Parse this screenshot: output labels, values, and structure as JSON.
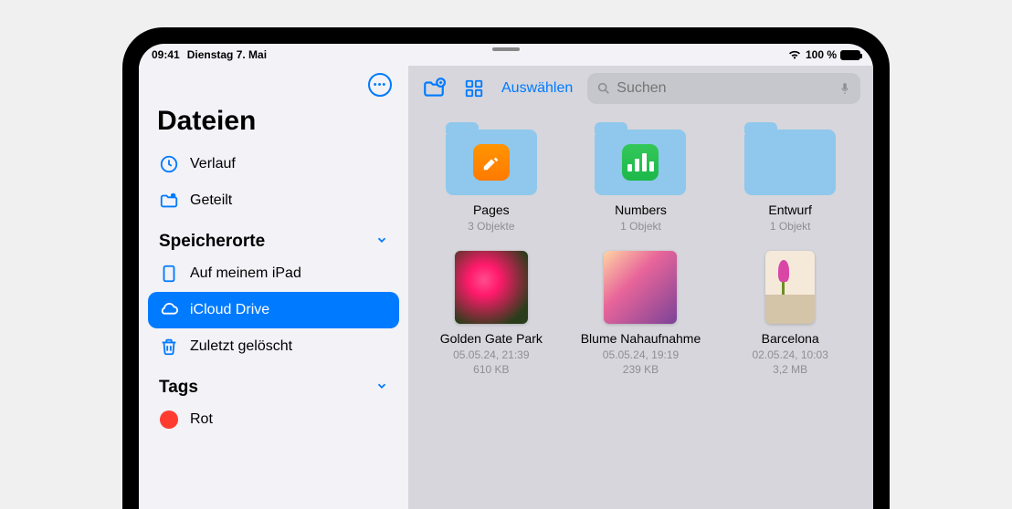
{
  "status": {
    "time": "09:41",
    "date": "Dienstag 7. Mai",
    "battery_pct": "100 %"
  },
  "sidebar": {
    "title": "Dateien",
    "recents": "Verlauf",
    "shared": "Geteilt",
    "locations_header": "Speicherorte",
    "on_ipad": "Auf meinem iPad",
    "icloud": "iCloud Drive",
    "trash": "Zuletzt gelöscht",
    "tags_header": "Tags",
    "tag_red": "Rot"
  },
  "toolbar": {
    "select": "Auswählen",
    "search_placeholder": "Suchen"
  },
  "grid": {
    "pages": {
      "name": "Pages",
      "sub": "3 Objekte"
    },
    "numbers": {
      "name": "Numbers",
      "sub": "1 Objekt"
    },
    "entwurf": {
      "name": "Entwurf",
      "sub": "1 Objekt"
    },
    "golden": {
      "name": "Golden Gate Park",
      "date": "05.05.24, 21:39",
      "size": "610 KB"
    },
    "blume": {
      "name": "Blume Nahaufnahme",
      "date": "05.05.24, 19:19",
      "size": "239 KB"
    },
    "barcelona": {
      "name": "Barcelona",
      "date": "02.05.24, 10:03",
      "size": "3,2 MB"
    }
  },
  "colors": {
    "accent": "#007aff",
    "tag_red": "#ff3b30"
  }
}
